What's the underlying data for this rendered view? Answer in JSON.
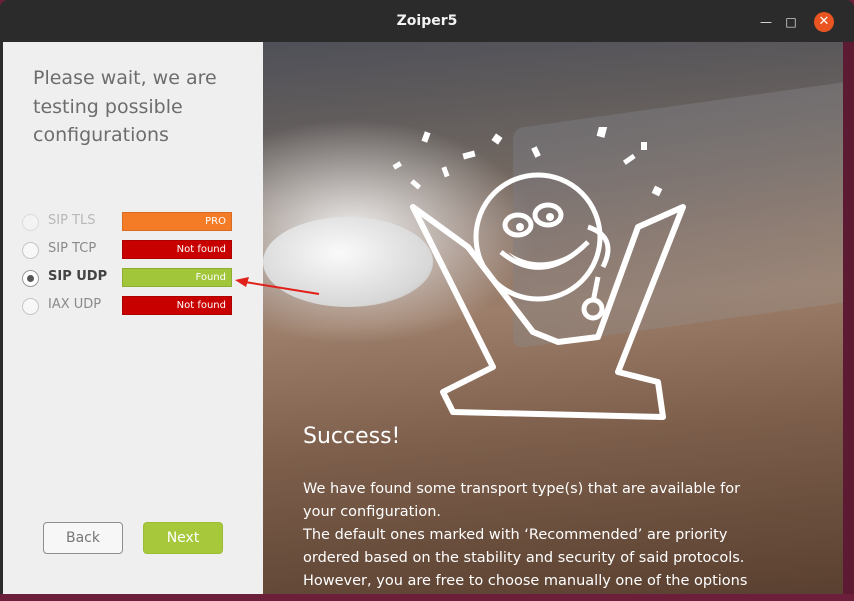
{
  "window": {
    "title": "Zoiper5",
    "minimize_icon": "minimize-icon",
    "maximize_icon": "maximize-icon",
    "close_icon": "close-icon"
  },
  "left_panel": {
    "heading": [
      "Please wait, we are",
      "testing possible",
      "configurations"
    ],
    "options": [
      {
        "label": "SIP TLS",
        "status": "PRO",
        "color": "#f57c27",
        "state": "disabled"
      },
      {
        "label": "SIP TCP",
        "status": "Not found",
        "color": "#c80000",
        "state": "normal"
      },
      {
        "label": "SIP UDP",
        "status": "Found",
        "color": "#a2c63a",
        "state": "selected"
      },
      {
        "label": "IAX UDP",
        "status": "Not found",
        "color": "#c80000",
        "state": "normal"
      }
    ],
    "back_label": "Back",
    "next_label": "Next"
  },
  "right_panel": {
    "success_title": "Success!",
    "description": [
      " We have found some transport type(s) that are available for",
      "your configuration.",
      "The default ones marked with ‘Recommended’ are priority",
      "ordered based on the stability and security of said protocols.",
      "However, you are free to choose manually one of the options"
    ]
  },
  "colors": {
    "accent_close": "#e95420",
    "next_button": "#a6c83a",
    "annotation_arrow": "#e0201a"
  }
}
